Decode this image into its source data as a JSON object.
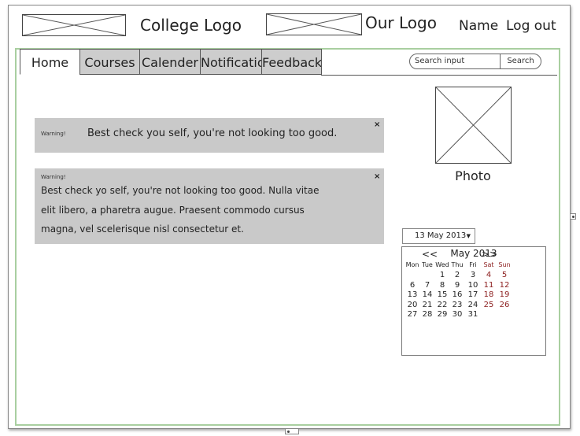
{
  "header": {
    "college_logo": "College Logo",
    "our_logo": "Our Logo",
    "name": "Name",
    "logout": "Log out"
  },
  "tabs": [
    {
      "label": "Home",
      "active": true
    },
    {
      "label": "Courses",
      "active": false
    },
    {
      "label": "Calender",
      "active": false
    },
    {
      "label": "Notification",
      "active": false
    },
    {
      "label": "Feedback",
      "active": false
    }
  ],
  "search": {
    "placeholder": "Search input",
    "button": "Search"
  },
  "alerts": [
    {
      "label": "Warning!",
      "message": "Best check you self, you're not looking too good.",
      "close": "×"
    },
    {
      "label": "Warning!",
      "lines": [
        "Best check yo self, you're not looking too good. Nulla vitae",
        "elit libero, a pharetra augue. Praesent commodo cursus",
        "magna, vel scelerisque nisl consectetur et."
      ],
      "close": "×"
    }
  ],
  "photo": {
    "caption": "Photo"
  },
  "date_picker": {
    "value": "13 May 2013"
  },
  "calendar": {
    "prev": "<<",
    "month_title": "May 2013",
    "next": ">>",
    "weekdays": [
      "Mon",
      "Tue",
      "Wed",
      "Thu",
      "Fri",
      "Sat",
      "Sun"
    ],
    "weeks": [
      [
        "",
        "",
        "1",
        "2",
        "3",
        "4",
        "5"
      ],
      [
        "6",
        "7",
        "8",
        "9",
        "10",
        "11",
        "12"
      ],
      [
        "13",
        "14",
        "15",
        "16",
        "17",
        "18",
        "19"
      ],
      [
        "20",
        "21",
        "22",
        "23",
        "24",
        "25",
        "26"
      ],
      [
        "27",
        "28",
        "29",
        "30",
        "31",
        "",
        ""
      ]
    ],
    "weekend_color": "#8b1c1c"
  }
}
